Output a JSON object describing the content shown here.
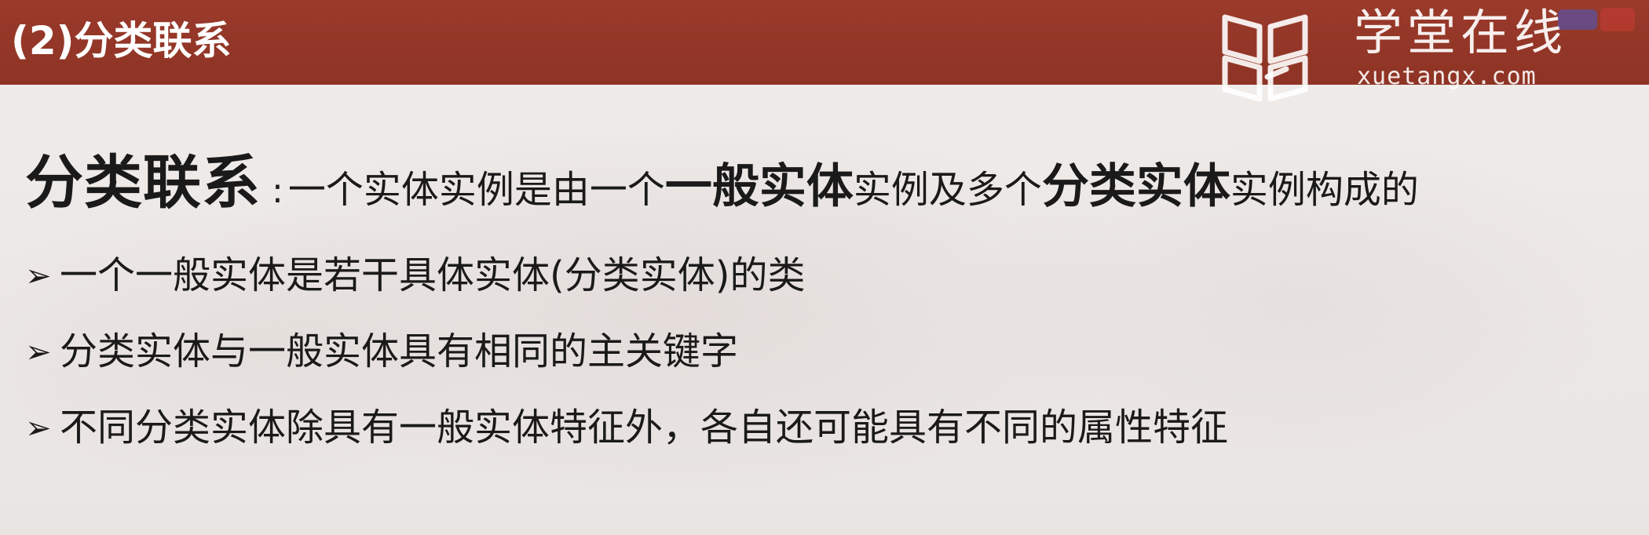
{
  "header": {
    "title": "(2)分类联系"
  },
  "watermark": {
    "name": "学堂在线",
    "url": "xuetangx.com"
  },
  "definition": {
    "term": "分类联系",
    "separator": ":",
    "text_1": "一个实体实例是由一个",
    "emphasis_1": "一般实体",
    "text_2": "实例",
    "text_3": "及多个",
    "emphasis_2": "分类实体",
    "text_4": "实例",
    "text_5": "构成的"
  },
  "bullets": {
    "marker": "➢",
    "items": [
      {
        "text": "一个一般实体是若干具体实体(分类实体)的类"
      },
      {
        "text": "分类实体与一般实体具有相同的主关键字"
      },
      {
        "text": "不同分类实体除具有一般实体特征外，各自还可能具有不同的属性特征"
      }
    ]
  },
  "colors": {
    "header_bar": "#973828",
    "header_text": "#ffffff",
    "body_text": "#1a1a1a",
    "background": "#ece9e7"
  }
}
